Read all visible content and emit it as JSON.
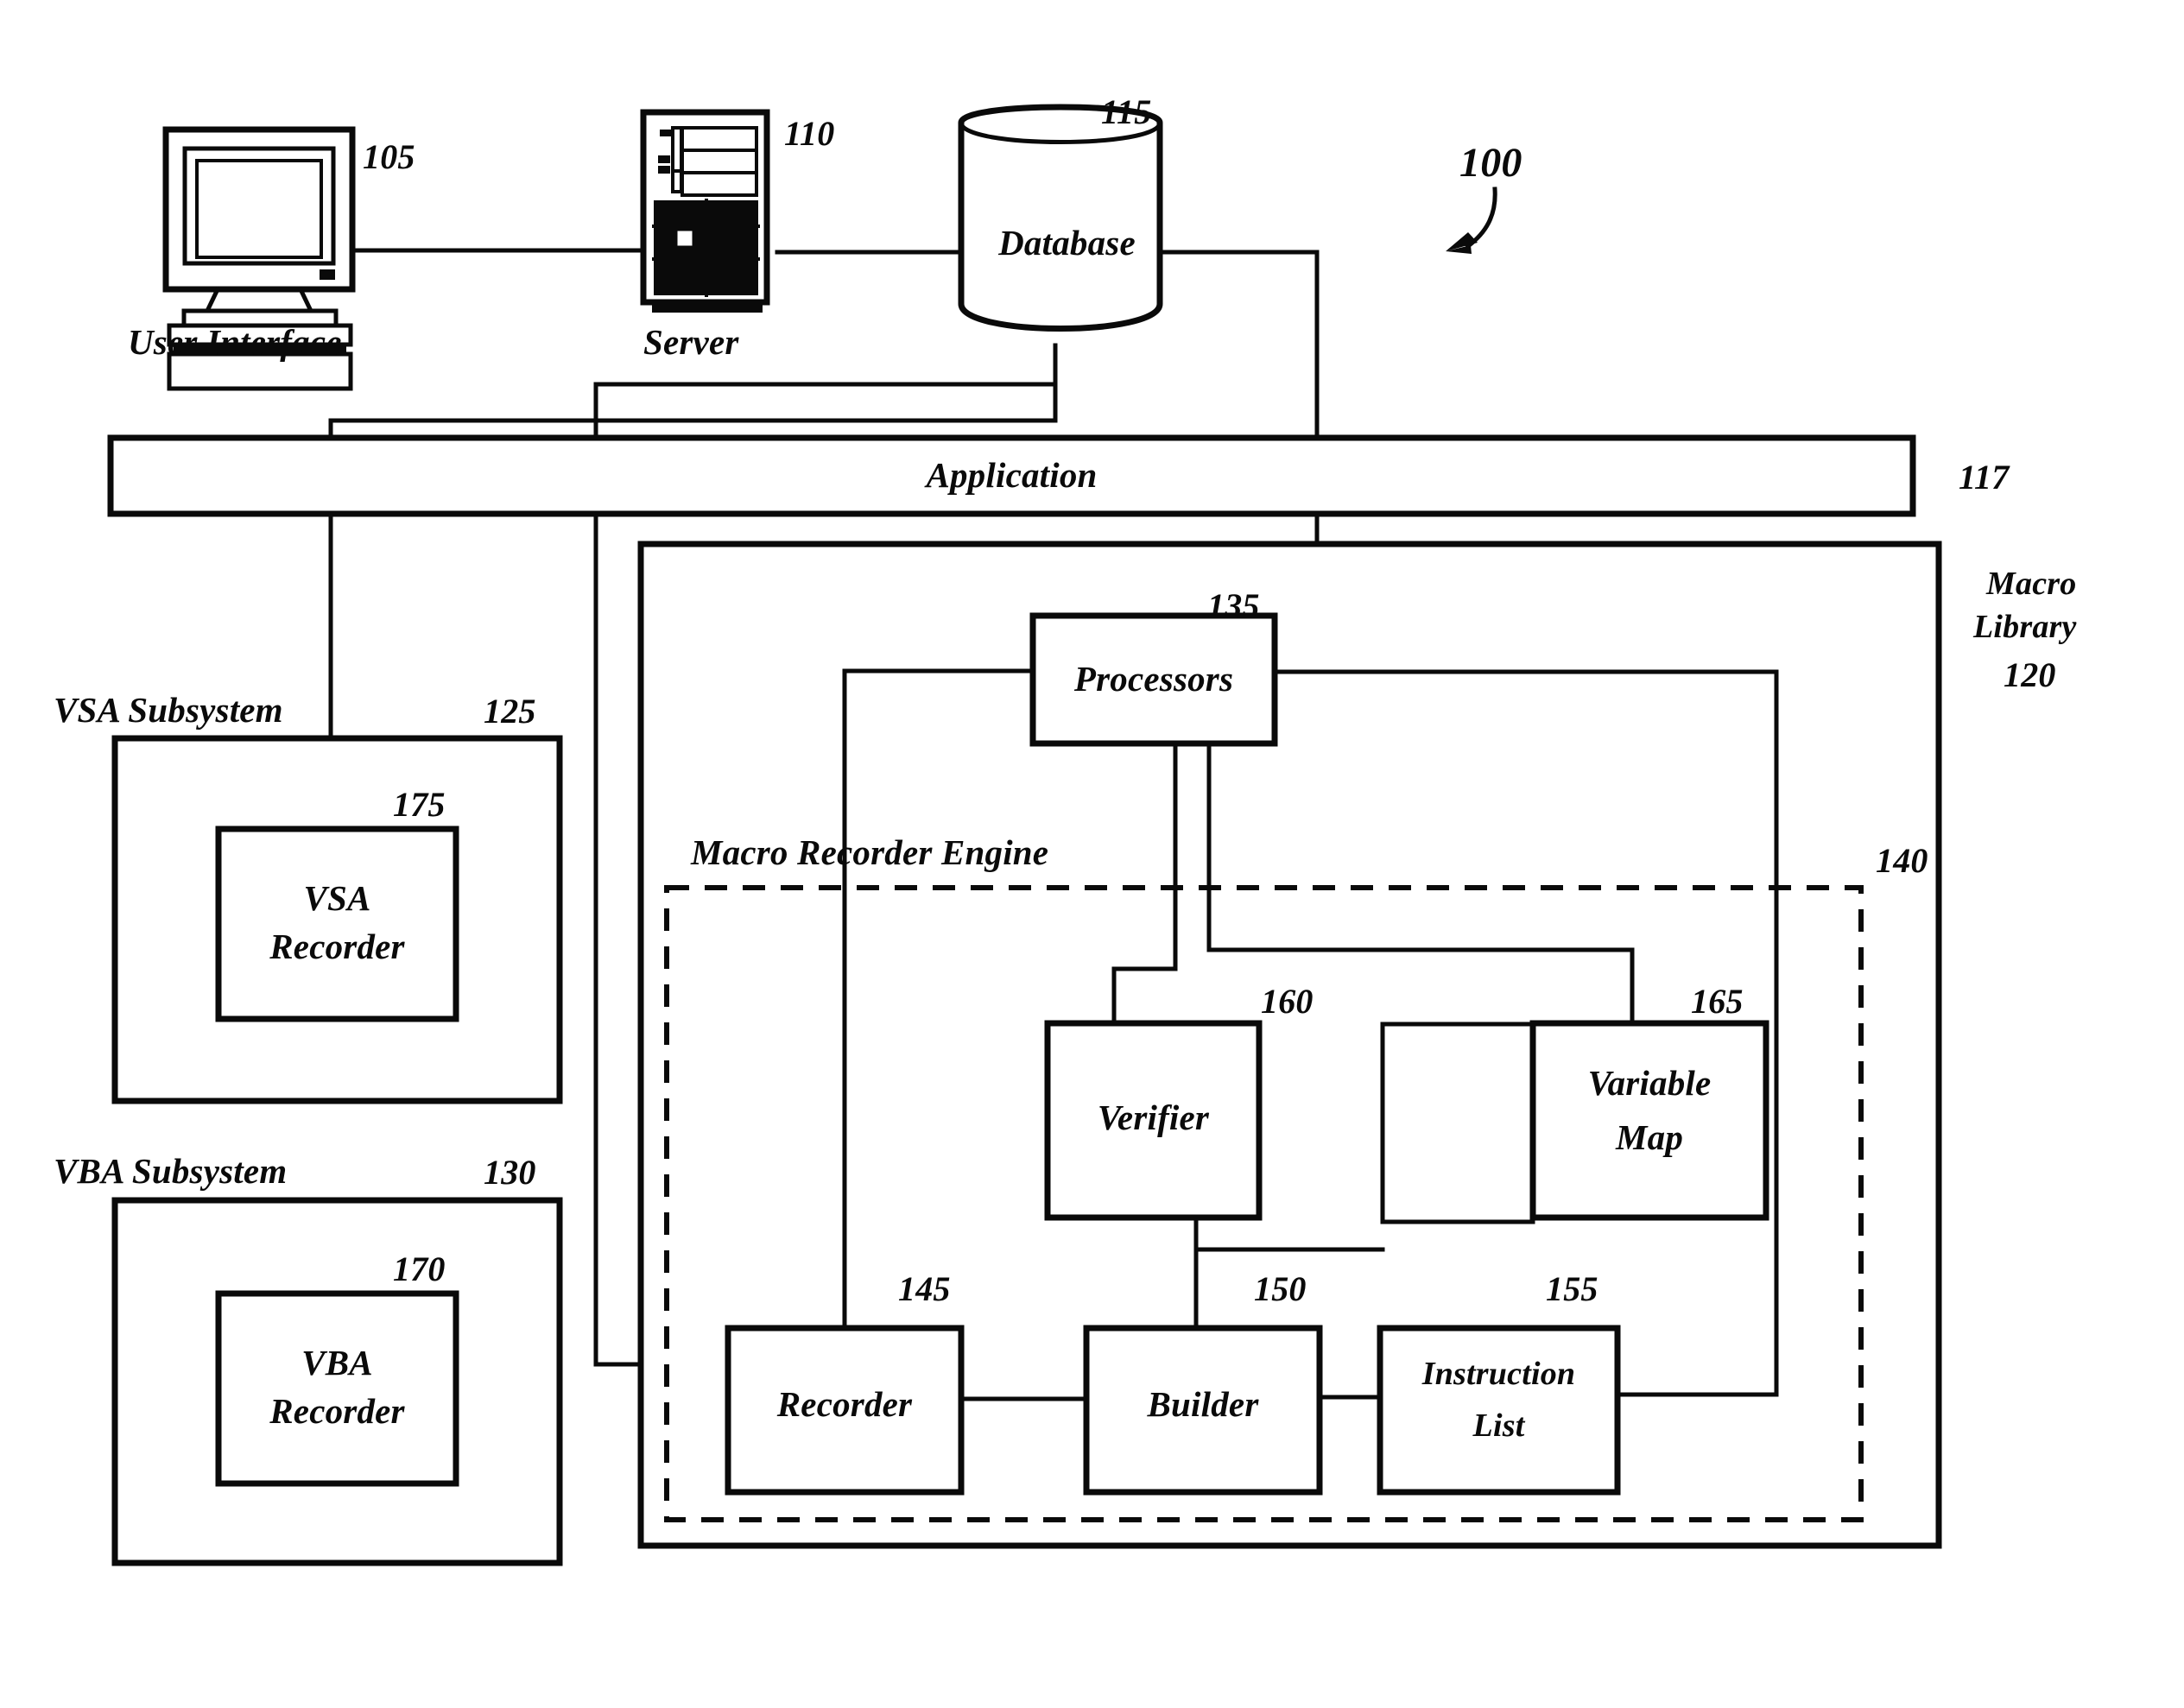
{
  "figure": {
    "overall_ref": "100",
    "domain": "system block diagram"
  },
  "top_row": {
    "user_interface": {
      "label": "User Interface",
      "ref": "105",
      "icon": "desktop-computer-icon"
    },
    "server": {
      "label": "Server",
      "ref": "110",
      "icon": "server-tower-icon"
    },
    "database": {
      "label": "Database",
      "ref": "115",
      "icon": "database-cylinder-icon"
    }
  },
  "application": {
    "label": "Application",
    "ref": "117"
  },
  "macro_library": {
    "label": "Macro Library",
    "ref": "120"
  },
  "vsa_subsystem": {
    "label": "VSA Subsystem",
    "ref": "125",
    "inner": {
      "label": "VSA Recorder",
      "line1": "VSA",
      "line2": "Recorder",
      "ref": "175"
    }
  },
  "vba_subsystem": {
    "label": "VBA Subsystem",
    "ref": "130",
    "inner": {
      "label": "VBA Recorder",
      "line1": "VBA",
      "line2": "Recorder",
      "ref": "170"
    }
  },
  "processors": {
    "label": "Processors",
    "ref": "135"
  },
  "macro_recorder_engine": {
    "label": "Macro Recorder Engine",
    "ref": "140"
  },
  "engine_blocks": {
    "recorder": {
      "label": "Recorder",
      "ref": "145"
    },
    "builder": {
      "label": "Builder",
      "ref": "150"
    },
    "instruction_list": {
      "label": "Instruction List",
      "line1": "Instruction",
      "line2": "List",
      "ref": "155"
    },
    "verifier": {
      "label": "Verifier",
      "ref": "160"
    },
    "variable_map": {
      "label": "Variable Map",
      "line1": "Variable",
      "line2": "Map",
      "ref": "165"
    }
  },
  "colors": {
    "ink": "#0a0a0a",
    "paper": "#ffffff"
  }
}
